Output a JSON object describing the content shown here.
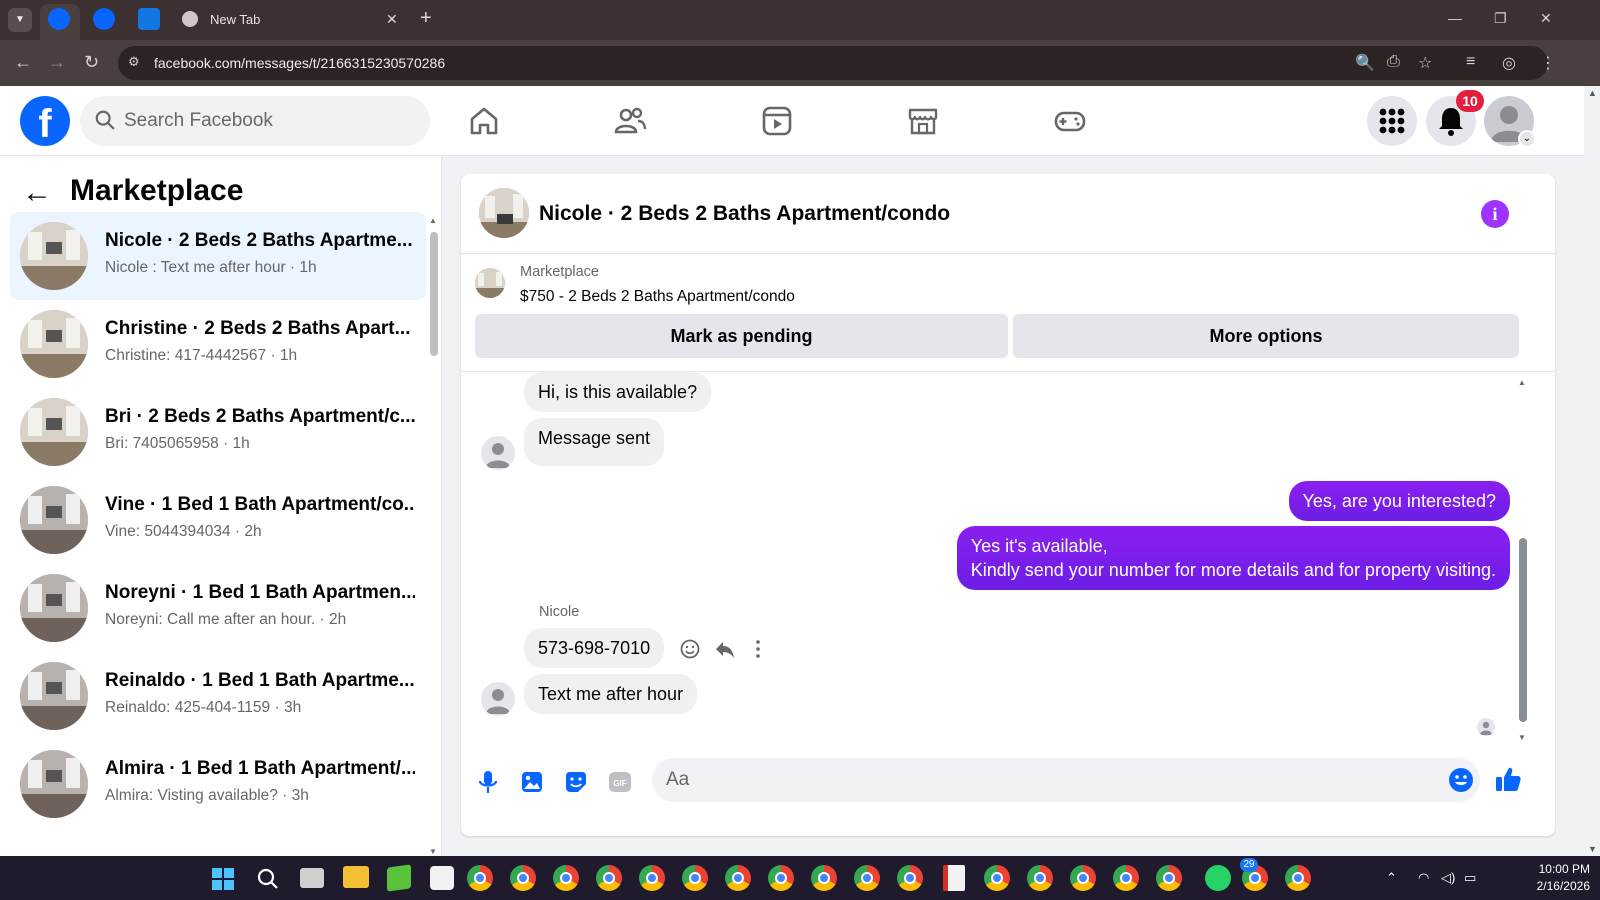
{
  "browser": {
    "tabs": [
      {
        "label": "",
        "icon": "facebook-icon"
      },
      {
        "label": "",
        "icon": "facebook-icon"
      },
      {
        "label": "",
        "icon": "zillow-icon"
      },
      {
        "label": "New Tab",
        "icon": "chrome-icon"
      }
    ],
    "url": "facebook.com/messages/t/2166315230570286"
  },
  "header": {
    "search_placeholder": "Search Facebook",
    "notifications_count": "10"
  },
  "sidebar": {
    "title": "Marketplace",
    "conversations": [
      {
        "title": "Nicole · 2 Beds 2 Baths Apartme...",
        "subtitle": "Nicole : Text me after hour · 1h",
        "active": true
      },
      {
        "title": "Christine · 2 Beds 2 Baths Apart...",
        "subtitle": "Christine: 417-4442567 · 1h"
      },
      {
        "title": "Bri · 2 Beds 2 Baths Apartment/c...",
        "subtitle": "Bri: 7405065958 · 1h"
      },
      {
        "title": "Vine · 1 Bed 1 Bath Apartment/co...",
        "subtitle": "Vine: 5044394034 · 2h"
      },
      {
        "title": "Noreyni · 1 Bed 1 Bath Apartmen...",
        "subtitle": "Noreyni: Call me after an hour. · 2h"
      },
      {
        "title": "Reinaldo · 1 Bed 1 Bath Apartme...",
        "subtitle": "Reinaldo: 425-404-1159 · 3h"
      },
      {
        "title": "Almira · 1 Bed 1 Bath Apartment/...",
        "subtitle": "Almira: Visting available? · 3h"
      }
    ]
  },
  "chat": {
    "title": "Nicole · 2 Beds 2 Baths Apartment/condo",
    "listing": {
      "source": "Marketplace",
      "title": "$750 - 2 Beds 2 Baths Apartment/condo",
      "mark_pending_label": "Mark as pending",
      "more_options_label": "More options"
    },
    "messages": [
      {
        "from": "them",
        "text": "Hi, is this available?"
      },
      {
        "from": "them",
        "text": "Message sent"
      },
      {
        "from": "me",
        "text": "Yes, are you interested?"
      },
      {
        "from": "me",
        "text": "Yes it's available,",
        "text2": "Kindly send your number for more details and for property visiting."
      },
      {
        "from": "them",
        "sender": "Nicole",
        "text": "573-698-7010"
      },
      {
        "from": "them",
        "text": "Text me after hour"
      }
    ],
    "composer_placeholder": "Aa"
  },
  "taskbar": {
    "whatsapp_badge": "29",
    "time": "10:00 PM",
    "date": "2/16/2026"
  },
  "colors": {
    "fb_blue": "#0866ff",
    "message_out": "#7b1fe8",
    "badge_red": "#e41e3f"
  }
}
